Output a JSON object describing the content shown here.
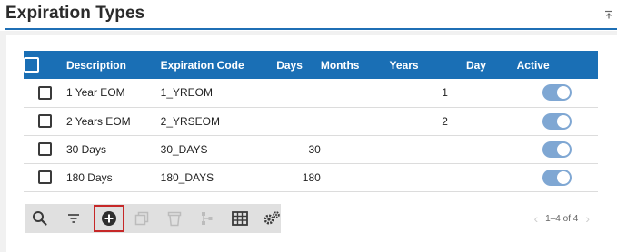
{
  "page": {
    "title": "Expiration Types"
  },
  "table": {
    "columns": [
      "Description",
      "Expiration Code",
      "Days",
      "Months",
      "Years",
      "Day",
      "Active"
    ],
    "rows": [
      {
        "description": "1 Year EOM",
        "code": "1_YREOM",
        "days": "",
        "months": "",
        "years": "1",
        "day": "",
        "active": true
      },
      {
        "description": "2 Years EOM",
        "code": "2_YRSEOM",
        "days": "",
        "months": "",
        "years": "2",
        "day": "",
        "active": true
      },
      {
        "description": "30 Days",
        "code": "30_DAYS",
        "days": "30",
        "months": "",
        "years": "",
        "day": "",
        "active": true
      },
      {
        "description": "180 Days",
        "code": "180_DAYS",
        "days": "180",
        "months": "",
        "years": "",
        "day": "",
        "active": true
      }
    ]
  },
  "toolbar": {
    "buttons": [
      {
        "icon": "search-icon",
        "enabled": true
      },
      {
        "icon": "filter-icon",
        "enabled": true
      },
      {
        "icon": "add-icon",
        "enabled": true,
        "highlighted": true
      },
      {
        "icon": "copy-icon",
        "enabled": false
      },
      {
        "icon": "delete-icon",
        "enabled": false
      },
      {
        "icon": "hierarchy-icon",
        "enabled": false
      },
      {
        "icon": "grid-view-icon",
        "enabled": true
      },
      {
        "icon": "settings-icon",
        "enabled": true
      }
    ]
  },
  "pager": {
    "range": "1–4 of 4"
  },
  "colors": {
    "header_bg": "#1a6fb5",
    "toggle_on": "#7fa7d3",
    "highlight": "#c62828"
  }
}
